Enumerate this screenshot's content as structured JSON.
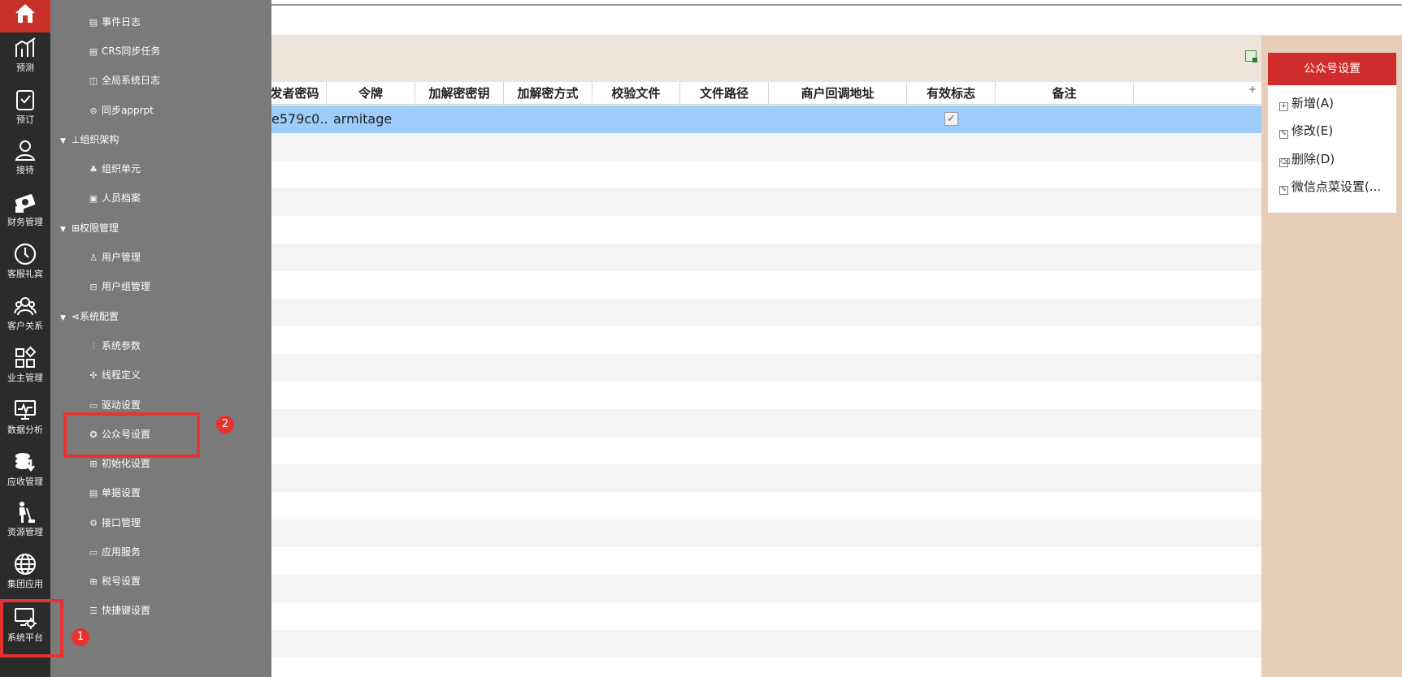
{
  "sidebar": {
    "items": [
      {
        "label": "预测",
        "icon": "forecast-chart-icon"
      },
      {
        "label": "预订",
        "icon": "booking-clipboard-icon"
      },
      {
        "label": "接待",
        "icon": "reception-person-icon"
      },
      {
        "label": "财务管理",
        "icon": "finance-money-icon"
      },
      {
        "label": "客服礼宾",
        "icon": "concierge-clock-icon"
      },
      {
        "label": "客户关系",
        "icon": "customer-relations-icon"
      },
      {
        "label": "业主管理",
        "icon": "owner-grid-icon"
      },
      {
        "label": "数据分析",
        "icon": "data-analysis-monitor-icon"
      },
      {
        "label": "应收管理",
        "icon": "receivable-coins-icon"
      },
      {
        "label": "资源管理",
        "icon": "resource-cleaning-icon"
      },
      {
        "label": "集团应用",
        "icon": "group-globe-icon"
      },
      {
        "label": "系统平台",
        "icon": "system-platform-gear-icon"
      }
    ]
  },
  "menu": {
    "items": [
      {
        "type": "item",
        "label": "事件日志",
        "icon": "doc-icon"
      },
      {
        "type": "item",
        "label": "CRS同步任务",
        "icon": "doc-icon"
      },
      {
        "type": "item",
        "label": "全局系统日志",
        "icon": "log-icon"
      },
      {
        "type": "item",
        "label": "同步apprpt",
        "icon": "sync-icon"
      },
      {
        "type": "group",
        "label": "组织架构",
        "icon": "org-tree-icon"
      },
      {
        "type": "item",
        "label": "组织单元",
        "icon": "org-unit-icon"
      },
      {
        "type": "item",
        "label": "人员档案",
        "icon": "id-card-icon"
      },
      {
        "type": "group",
        "label": "权限管理",
        "icon": "permission-grid-icon"
      },
      {
        "type": "item",
        "label": "用户管理",
        "icon": "user-icon"
      },
      {
        "type": "item",
        "label": "用户组管理",
        "icon": "user-group-icon"
      },
      {
        "type": "group",
        "label": "系统配置",
        "icon": "share-nodes-icon"
      },
      {
        "type": "item",
        "label": "系统参数",
        "icon": "sliders-icon"
      },
      {
        "type": "item",
        "label": "线程定义",
        "icon": "thread-icon"
      },
      {
        "type": "item",
        "label": "驱动设置",
        "icon": "driver-icon"
      },
      {
        "type": "item",
        "label": "公众号设置",
        "icon": "badge-check-icon"
      },
      {
        "type": "item",
        "label": "初始化设置",
        "icon": "grid-icon"
      },
      {
        "type": "item",
        "label": "单据设置",
        "icon": "list-doc-icon"
      },
      {
        "type": "item",
        "label": "接口管理",
        "icon": "gear-icon"
      },
      {
        "type": "item",
        "label": "应用服务",
        "icon": "monitor-icon"
      },
      {
        "type": "item",
        "label": "税号设置",
        "icon": "grid-icon"
      },
      {
        "type": "item",
        "label": "快捷键设置",
        "icon": "list-icon"
      }
    ]
  },
  "grid": {
    "columns": [
      "发者密码",
      "令牌",
      "加解密密钥",
      "加解密方式",
      "校验文件",
      "文件路径",
      "商户回调地址",
      "有效标志",
      "备注"
    ],
    "plus_label": "+",
    "row": {
      "password": "e579c0...",
      "token": "armitage",
      "valid": true,
      "check_glyph": "✓"
    }
  },
  "panel": {
    "title": "公众号设置",
    "actions": [
      {
        "label": "新增(A)",
        "icon": "add-icon",
        "glyph": "+"
      },
      {
        "label": "修改(E)",
        "icon": "edit-icon",
        "glyph": "✎"
      },
      {
        "label": "删除(D)",
        "icon": "delete-icon",
        "glyph": "⌫"
      },
      {
        "label": "微信点菜设置(...",
        "icon": "edit-icon",
        "glyph": "✎"
      }
    ]
  },
  "annotations": {
    "badge1": "1",
    "badge2": "2"
  },
  "colors": {
    "accent_red": "#cf2c2c",
    "selected_row": "#9dcbfa",
    "sidebar_dark": "#2b2b2b",
    "menu_grey": "#7a7a7a",
    "panel_tan": "#e6cdb7"
  }
}
